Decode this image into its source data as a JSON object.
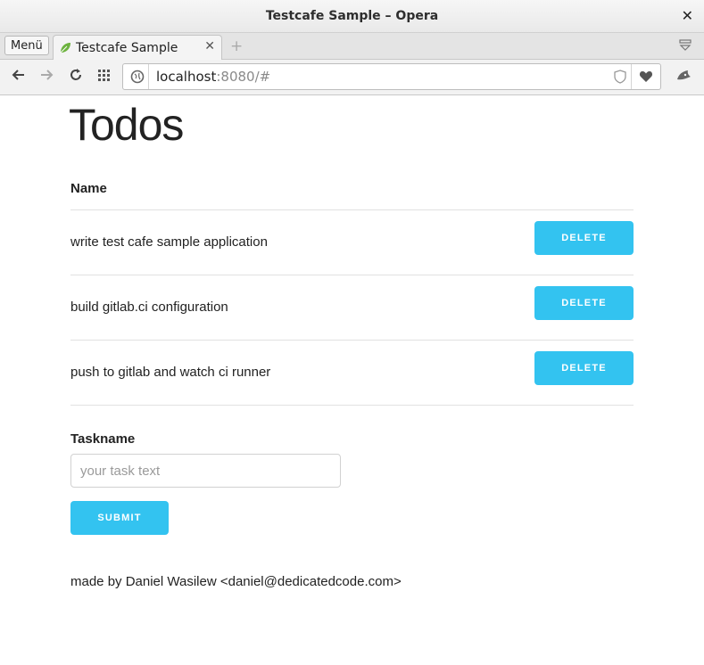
{
  "window": {
    "title": "Testcafe Sample – Opera",
    "close_glyph": "✕"
  },
  "tabstrip": {
    "menu_label": "Menü",
    "tabs": [
      {
        "title": "Testcafe Sample",
        "close_glyph": "✕",
        "icon": "spring-leaf-icon"
      }
    ],
    "new_tab_glyph": "+"
  },
  "navbar": {
    "url_host": "localhost",
    "url_rest": ":8080/#",
    "icons": [
      "back-arrow-icon",
      "forward-arrow-icon",
      "reload-icon",
      "speed-dial-icon",
      "globe-icon",
      "shield-icon",
      "heart-icon",
      "extension-icon"
    ]
  },
  "page": {
    "title": "Todos",
    "column_header": "Name",
    "todos": [
      {
        "name": "write test cafe sample application",
        "delete_label": "DELETE"
      },
      {
        "name": "build gitlab.ci configuration",
        "delete_label": "DELETE"
      },
      {
        "name": "push to gitlab and watch ci runner",
        "delete_label": "DELETE"
      }
    ],
    "form": {
      "label": "Taskname",
      "placeholder": "your task text",
      "value": "",
      "submit_label": "SUBMIT"
    },
    "footer": "made by Daniel Wasilew <daniel@dedicatedcode.com>"
  },
  "colors": {
    "accent": "#33c3f0",
    "text": "#222222",
    "divider": "#e1e1e1"
  }
}
